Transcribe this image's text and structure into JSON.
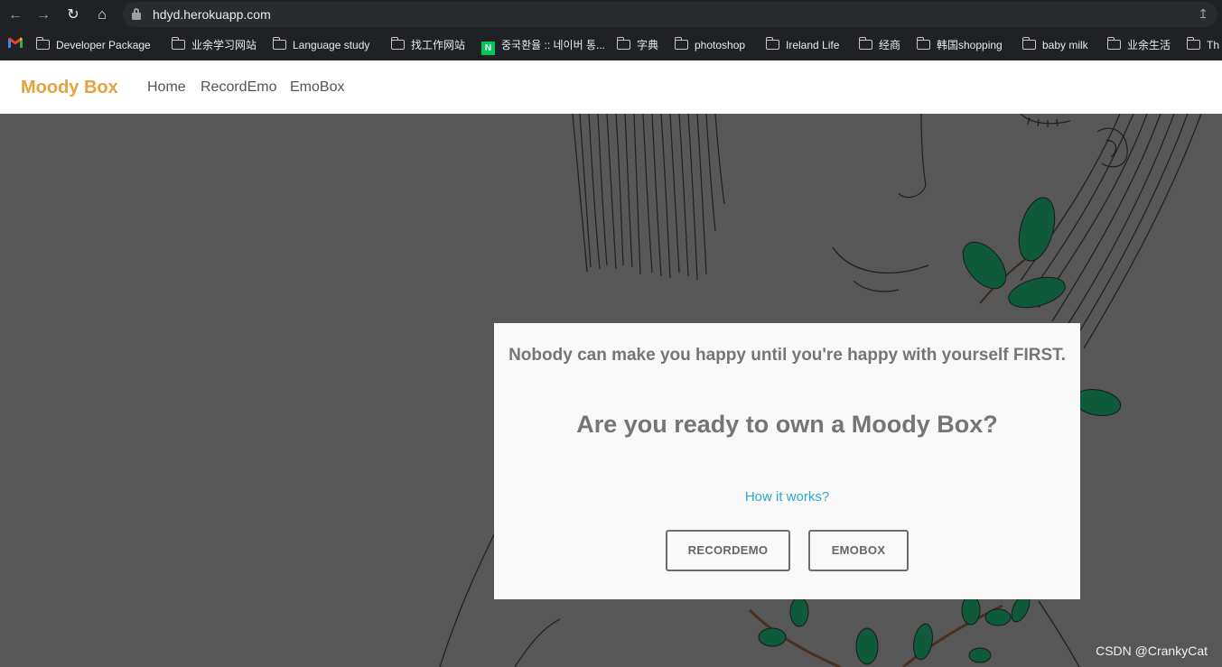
{
  "browser": {
    "url": "hdyd.herokuapp.com",
    "bookmarks": [
      "Developer Package",
      "业余学习网站",
      "Language study",
      "找工作网站",
      "중국환율 :: 네이버 통...",
      "字典",
      "photoshop",
      "Ireland Life",
      "经商",
      "韩国shopping",
      "baby milk",
      "业余生活",
      "Th"
    ]
  },
  "site": {
    "brand": "Moody Box",
    "brand_color": "#e6a23c",
    "nav": [
      "Home",
      "RecordEmo",
      "EmoBox"
    ]
  },
  "card": {
    "quote": "Nobody can make you happy until you're happy with yourself FIRST.",
    "headline": "Are you ready to own a Moody Box?",
    "link": "How it works?",
    "buttons": [
      "RECORDEMO",
      "EMOBOX"
    ]
  },
  "watermark": "CSDN @CrankyCat"
}
